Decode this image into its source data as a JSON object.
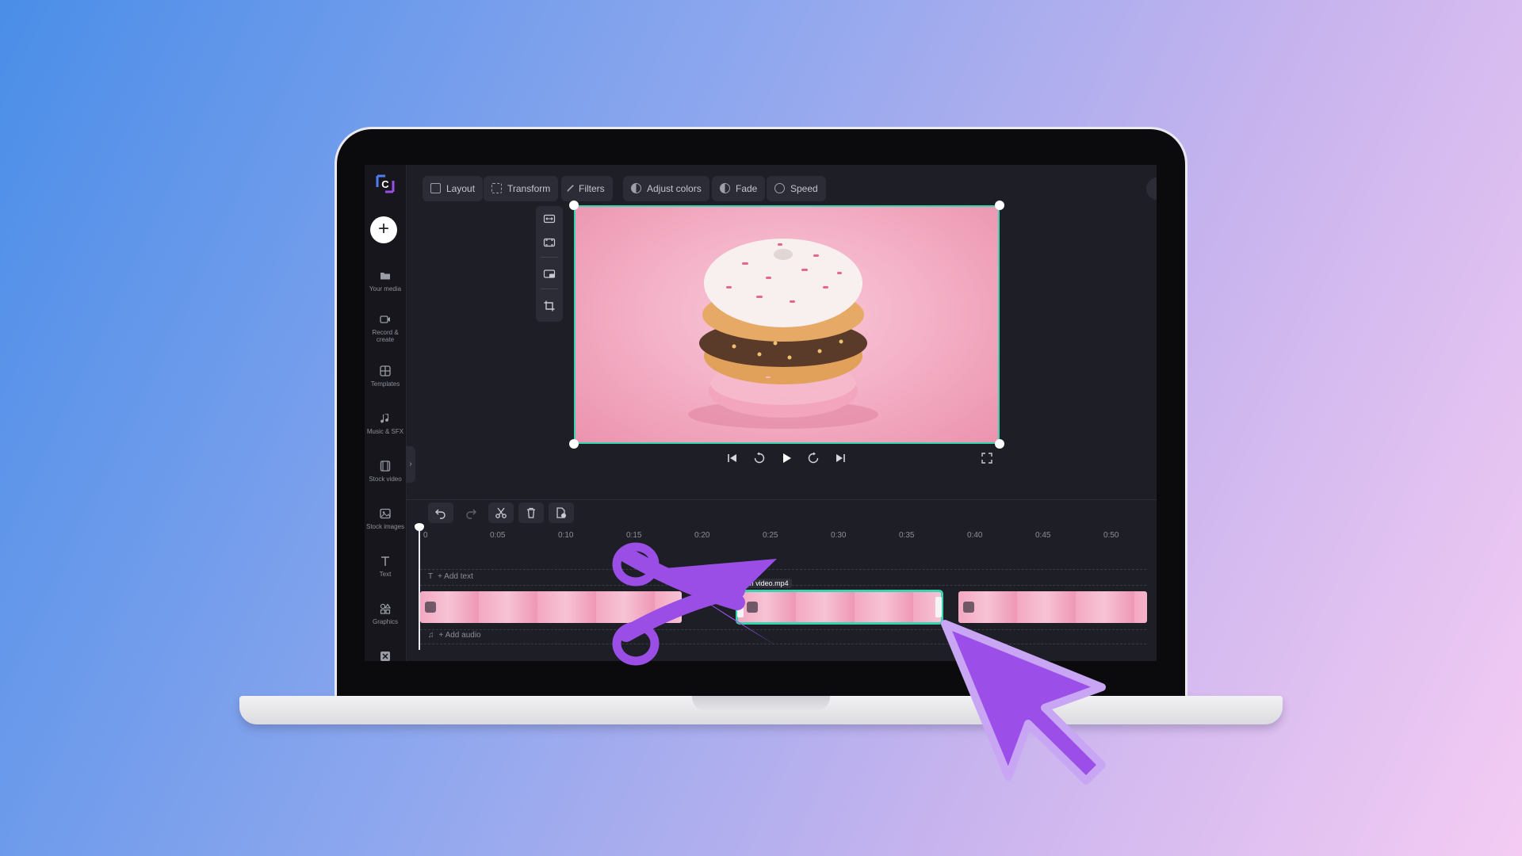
{
  "app": {
    "logo_letter": "C",
    "add_label": "+"
  },
  "sidebar": {
    "items": [
      {
        "label": "Your media",
        "icon": "folder-icon"
      },
      {
        "label": "Record & create",
        "icon": "video-camera-icon"
      },
      {
        "label": "Templates",
        "icon": "templates-icon"
      },
      {
        "label": "Music & SFX",
        "icon": "music-note-icon"
      },
      {
        "label": "Stock video",
        "icon": "film-icon"
      },
      {
        "label": "Stock images",
        "icon": "image-icon"
      },
      {
        "label": "Text",
        "icon": "text-icon"
      },
      {
        "label": "Graphics",
        "icon": "shapes-icon"
      }
    ]
  },
  "toolbar": {
    "layout": "Layout",
    "transform": "Transform",
    "filters": "Filters",
    "adjust_colors": "Adjust colors",
    "fade": "Fade",
    "speed": "Speed"
  },
  "timeline": {
    "ticks": [
      "0",
      "0:05",
      "0:10",
      "0:15",
      "0:20",
      "0:25",
      "0:30",
      "0:35",
      "0:40",
      "0:45",
      "0:50"
    ],
    "add_text": "+ Add text",
    "add_audio": "+ Add audio",
    "selected_clip_name": "Trim video.mp4"
  },
  "colors": {
    "accent_teal": "#39d3b0",
    "brand_purple": "#9a4ee6",
    "editor_bg": "#1d1e26"
  }
}
